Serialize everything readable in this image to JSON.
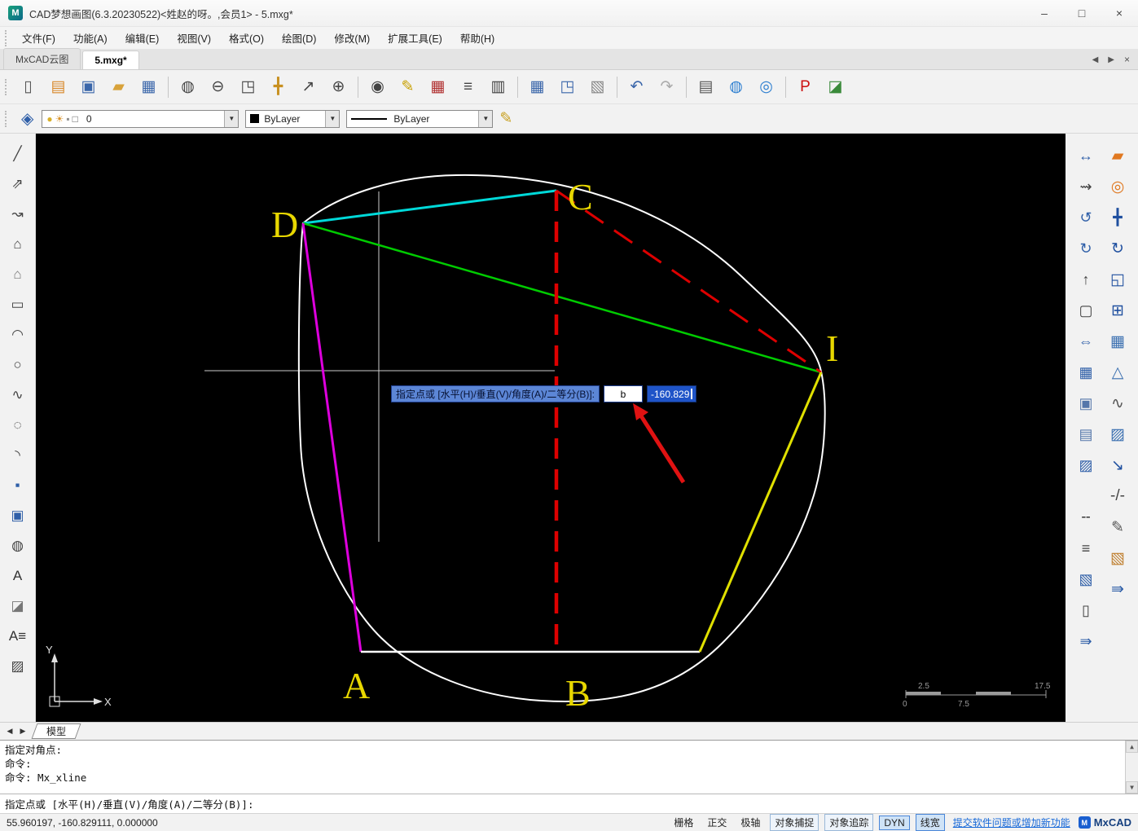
{
  "window": {
    "title": "CAD梦想画图(6.3.20230522)<姓赵的呀。,会员1> - 5.mxg*",
    "minimize": "–",
    "maximize": "□",
    "close": "×"
  },
  "menu": {
    "items": [
      {
        "name": "menu-file",
        "label": "文件(F)"
      },
      {
        "name": "menu-function",
        "label": "功能(A)"
      },
      {
        "name": "menu-edit",
        "label": "编辑(E)"
      },
      {
        "name": "menu-view",
        "label": "视图(V)"
      },
      {
        "name": "menu-format",
        "label": "格式(O)"
      },
      {
        "name": "menu-draw",
        "label": "绘图(D)"
      },
      {
        "name": "menu-modify",
        "label": "修改(M)"
      },
      {
        "name": "menu-express-tools",
        "label": "扩展工具(E)"
      },
      {
        "name": "menu-help",
        "label": "帮助(H)"
      }
    ]
  },
  "doc_tabs": {
    "items": [
      {
        "name": "tab-mxcad-cloud",
        "label": "MxCAD云图"
      },
      {
        "name": "tab-5mxg",
        "label": "5.mxg*",
        "active": true
      }
    ],
    "prev": "◀",
    "next": "▶",
    "close": "×"
  },
  "toolbar_main": {
    "items": [
      {
        "name": "new-file",
        "glyph": "▯",
        "color": "#555555"
      },
      {
        "name": "new-from-template",
        "glyph": "▤",
        "color": "#d8882a"
      },
      {
        "name": "save",
        "glyph": "▣",
        "color": "#3a66aa"
      },
      {
        "name": "open-file",
        "glyph": "▰",
        "color": "#d8a23a"
      },
      {
        "name": "save-as",
        "glyph": "▦",
        "color": "#3a66aa"
      },
      {
        "sep": true
      },
      {
        "name": "find",
        "glyph": "◍",
        "color": "#444444"
      },
      {
        "name": "zoom-out",
        "glyph": "⊖",
        "color": "#444444"
      },
      {
        "name": "zoom-extents",
        "glyph": "◳",
        "color": "#444444"
      },
      {
        "name": "pan",
        "glyph": "╋",
        "color": "#c89020"
      },
      {
        "name": "zoom-scale",
        "glyph": "↗",
        "color": "#444444"
      },
      {
        "name": "zoom-window",
        "glyph": "⊕",
        "color": "#444444"
      },
      {
        "sep": true
      },
      {
        "name": "zoom-object",
        "glyph": "◉",
        "color": "#444444"
      },
      {
        "name": "quick-draw",
        "glyph": "✎",
        "color": "#c8a000"
      },
      {
        "name": "table",
        "glyph": "▦",
        "color": "#b03030"
      },
      {
        "name": "text-style",
        "glyph": "≡",
        "color": "#444444"
      },
      {
        "name": "sheet",
        "glyph": "▥",
        "color": "#444444"
      },
      {
        "sep": true
      },
      {
        "name": "layout-table",
        "glyph": "▦",
        "color": "#3a66aa"
      },
      {
        "name": "export-layout",
        "glyph": "◳",
        "color": "#3a66aa"
      },
      {
        "name": "sheets",
        "glyph": "▧",
        "color": "#888888"
      },
      {
        "sep": true
      },
      {
        "name": "undo",
        "glyph": "↶",
        "color": "#3a66aa"
      },
      {
        "name": "redo",
        "glyph": "↷",
        "color": "#aaaaaa"
      },
      {
        "sep": true
      },
      {
        "name": "print",
        "glyph": "▤",
        "color": "#555555"
      },
      {
        "name": "web-publish",
        "glyph": "◍",
        "color": "#2e7fd0"
      },
      {
        "name": "web-share",
        "glyph": "◎",
        "color": "#2e7fd0"
      },
      {
        "sep": true
      },
      {
        "name": "pdf-export",
        "glyph": "P",
        "color": "#cc1111"
      },
      {
        "name": "image-export",
        "glyph": "◪",
        "color": "#3a8a3a"
      }
    ]
  },
  "format_bar": {
    "chips": [
      {
        "name": "layer-on-icon",
        "glyph": "●",
        "color": "#d8b02a"
      },
      {
        "name": "layer-freeze-icon",
        "glyph": "☀",
        "color": "#d8922a"
      },
      {
        "name": "layer-lock-icon",
        "glyph": "▪",
        "color": "#909090"
      },
      {
        "name": "layer-color-chip",
        "glyph": "□",
        "color": "#666666"
      }
    ],
    "layer_value": "0",
    "color_value": "ByLayer",
    "linetype_value": "ByLayer",
    "dropdown_arrow": "▼",
    "layers_panel_glyph": "◈",
    "draw_color_glyph": "✎"
  },
  "left_toolbar": {
    "items": [
      {
        "name": "draw-line",
        "glyph": "╱",
        "color": "#444444"
      },
      {
        "name": "draw-xline",
        "glyph": "⇗",
        "color": "#444444"
      },
      {
        "name": "draw-polyline",
        "glyph": "↝",
        "color": "#444444"
      },
      {
        "name": "draw-polygon",
        "glyph": "⌂",
        "color": "#444444"
      },
      {
        "name": "draw-polygon-solid",
        "glyph": "⌂",
        "color": "#777777"
      },
      {
        "name": "draw-rectangle",
        "glyph": "▭",
        "color": "#444444"
      },
      {
        "name": "draw-arc",
        "glyph": "◠",
        "color": "#444444"
      },
      {
        "name": "draw-circle",
        "glyph": "○",
        "color": "#444444"
      },
      {
        "name": "draw-spline",
        "glyph": "∿",
        "color": "#444444"
      },
      {
        "name": "draw-ellipse",
        "glyph": "◌",
        "color": "#444444"
      },
      {
        "name": "draw-ellipse-arc",
        "glyph": "◝",
        "color": "#444444"
      },
      {
        "name": "draw-point",
        "glyph": "▪",
        "color": "#2f5fa8"
      },
      {
        "name": "draw-block",
        "glyph": "▣",
        "color": "#2f5fa8"
      },
      {
        "name": "draw-region",
        "glyph": "◍",
        "color": "#444444"
      },
      {
        "name": "draw-text",
        "glyph": "A",
        "color": "#333333"
      },
      {
        "name": "draw-image",
        "glyph": "◪",
        "color": "#777777"
      },
      {
        "name": "draw-mtext",
        "glyph": "A≡",
        "color": "#333333"
      },
      {
        "name": "draw-hatch",
        "glyph": "▨",
        "color": "#444444"
      }
    ]
  },
  "right_toolbar_inner": {
    "items": [
      {
        "name": "zoom-fit-width",
        "glyph": "↔",
        "color": "#2f5fa8"
      },
      {
        "name": "zoom-dynamic",
        "glyph": "⇝",
        "color": "#444444"
      },
      {
        "name": "zoom-previous",
        "glyph": "↺",
        "color": "#2f5fa8"
      },
      {
        "name": "zoom-realtime",
        "glyph": "↻",
        "color": "#2f5fa8"
      },
      {
        "name": "zoom-up",
        "glyph": "↑",
        "color": "#444444"
      },
      {
        "name": "zoom-rect",
        "glyph": "▢",
        "color": "#444444"
      },
      {
        "name": "zoom-all",
        "glyph": "⇔",
        "color": "#2f5fa8"
      },
      {
        "name": "array-grid",
        "glyph": "▦",
        "color": "#2f5fa8"
      },
      {
        "name": "copy-object",
        "glyph": "▣",
        "color": "#5577aa"
      },
      {
        "name": "paste-object",
        "glyph": "▤",
        "color": "#5577aa"
      },
      {
        "name": "hatch-tool",
        "glyph": "▨",
        "color": "#2f5fa8"
      },
      {
        "sep": true
      },
      {
        "name": "linetype-tool",
        "glyph": "╌",
        "color": "#444444"
      },
      {
        "name": "multiline-tool",
        "glyph": "≡",
        "color": "#444444"
      },
      {
        "name": "box-3d-tool",
        "glyph": "▧",
        "color": "#2f5fa8"
      },
      {
        "name": "sheet-tool",
        "glyph": "▯",
        "color": "#444444"
      },
      {
        "name": "align-tool",
        "glyph": "⇛",
        "color": "#2f5fa8"
      }
    ]
  },
  "right_toolbar_outer": {
    "items": [
      {
        "name": "erase",
        "glyph": "▰",
        "color": "#e07820"
      },
      {
        "name": "copy",
        "glyph": "◎",
        "color": "#e07820"
      },
      {
        "name": "move",
        "glyph": "╋",
        "color": "#1f4f9f"
      },
      {
        "name": "rotate",
        "glyph": "↻",
        "color": "#1f4f9f"
      },
      {
        "name": "scale",
        "glyph": "◱",
        "color": "#1f4f9f"
      },
      {
        "name": "offset",
        "glyph": "⊞",
        "color": "#1f4f9f"
      },
      {
        "name": "array",
        "glyph": "▦",
        "color": "#3a6fb0"
      },
      {
        "name": "mirror",
        "glyph": "△",
        "color": "#3a6fb0"
      },
      {
        "name": "fillet",
        "glyph": "∿",
        "color": "#555555"
      },
      {
        "name": "chamfer",
        "glyph": "▨",
        "color": "#3a6fb0"
      },
      {
        "name": "stretch",
        "glyph": "↘",
        "color": "#1f4f9f"
      },
      {
        "name": "break",
        "glyph": "-/-",
        "color": "#444444"
      },
      {
        "name": "explode",
        "glyph": "✎",
        "color": "#555555"
      },
      {
        "name": "view-3d",
        "glyph": "▧",
        "color": "#c08030"
      },
      {
        "name": "match-properties",
        "glyph": "⇛",
        "color": "#2f5fa8"
      }
    ]
  },
  "canvas": {
    "labels": [
      {
        "text": "D"
      },
      {
        "text": "C"
      },
      {
        "text": "A"
      },
      {
        "text": "B"
      },
      {
        "text": "I"
      }
    ],
    "colors": {
      "circle": "#ffffff",
      "cyan": "#00d9d9",
      "green": "#00cc00",
      "magenta": "#dd00dd",
      "red": "#dd0000",
      "yellow": "#e0e000",
      "white_line": "#ffffff",
      "label": "#e8d700",
      "annotation": "#e01212"
    },
    "dyn_input": {
      "prompt": "指定点或 [水平(H)/垂直(V)/角度(A)/二等分(B)]:",
      "field_value": "b",
      "coord_value": "-160.829"
    },
    "scale_bar": {
      "top_left": "2.5",
      "top_right": "17.5",
      "bottom_left": "0",
      "bottom_mid": "7.5"
    },
    "ucs": {
      "x": "X",
      "y": "Y"
    }
  },
  "model_bar": {
    "prev": "◀",
    "next": "▶",
    "tabs": [
      {
        "name": "tab-model",
        "label": "模型",
        "active": true
      }
    ]
  },
  "command": {
    "history": [
      "指定对角点:",
      "命令:",
      "命令: Mx_xline"
    ],
    "prompt": "指定点或 [水平(H)/垂直(V)/角度(A)/二等分(B)]:",
    "scroll_up": "▲",
    "scroll_down": "▼"
  },
  "status_bar": {
    "coordinates": "55.960197, -160.829111, 0.000000",
    "toggles": [
      {
        "name": "toggle-grid",
        "label": "栅格",
        "style": "flat"
      },
      {
        "name": "toggle-ortho",
        "label": "正交",
        "style": "flat"
      },
      {
        "name": "toggle-polar",
        "label": "极轴",
        "style": "flat"
      },
      {
        "name": "toggle-osnap",
        "label": "对象捕捉",
        "style": "outline",
        "active": true
      },
      {
        "name": "toggle-otrack",
        "label": "对象追踪",
        "style": "outline"
      },
      {
        "name": "toggle-dyn",
        "label": "DYN",
        "style": "blue",
        "active": true
      },
      {
        "name": "toggle-lineweight",
        "label": "线宽",
        "style": "blue",
        "active": true
      }
    ],
    "link": "提交软件问题或增加新功能",
    "brand": "MxCAD"
  }
}
